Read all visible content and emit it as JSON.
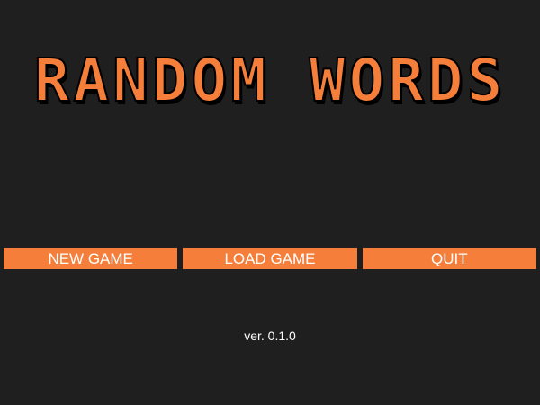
{
  "title": "RANDOM WORDS",
  "colors": {
    "background": "#1f1f1f",
    "accent": "#f57f3a",
    "title_shadow": "#000000",
    "button_text": "#ffffff"
  },
  "menu": {
    "new_game_label": "NEW GAME",
    "load_game_label": "LOAD GAME",
    "quit_label": "QUIT"
  },
  "version": "ver. 0.1.0"
}
